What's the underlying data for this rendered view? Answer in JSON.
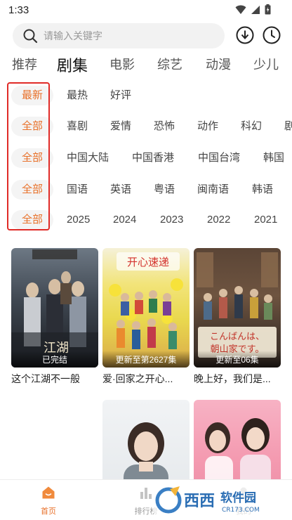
{
  "status": {
    "time": "1:33"
  },
  "search": {
    "placeholder": "请输入关键字"
  },
  "tabs": [
    "推荐",
    "剧集",
    "电影",
    "综艺",
    "动漫",
    "少儿"
  ],
  "filters": [
    {
      "active": "最新",
      "options": [
        "最热",
        "好评"
      ]
    },
    {
      "active": "全部",
      "options": [
        "喜剧",
        "爱情",
        "恐怖",
        "动作",
        "科幻",
        "剧"
      ]
    },
    {
      "active": "全部",
      "options": [
        "中国大陆",
        "中国香港",
        "中国台湾",
        "韩国"
      ]
    },
    {
      "active": "全部",
      "options": [
        "国语",
        "英语",
        "粤语",
        "闽南语",
        "韩语"
      ]
    },
    {
      "active": "全部",
      "options": [
        "2025",
        "2024",
        "2023",
        "2022",
        "2021"
      ]
    }
  ],
  "cards": [
    {
      "title": "这个江湖不一般",
      "caption": "已完结"
    },
    {
      "title": "爱·回家之开心...",
      "caption": "更新至第2627集"
    },
    {
      "title": "晚上好，我们是...",
      "caption": "更新至06集"
    },
    {
      "title": "",
      "caption": ""
    },
    {
      "title": "",
      "caption": ""
    },
    {
      "title": "",
      "caption": ""
    }
  ],
  "bottom_nav": [
    {
      "label": "首页"
    },
    {
      "label": "排行榜"
    },
    {
      "label": "我的"
    }
  ],
  "colors": {
    "accent": "#e8712a",
    "highlight_box": "#e02b27"
  },
  "watermark": {
    "brand": "西西软件园",
    "domain": "CR173.COM"
  }
}
